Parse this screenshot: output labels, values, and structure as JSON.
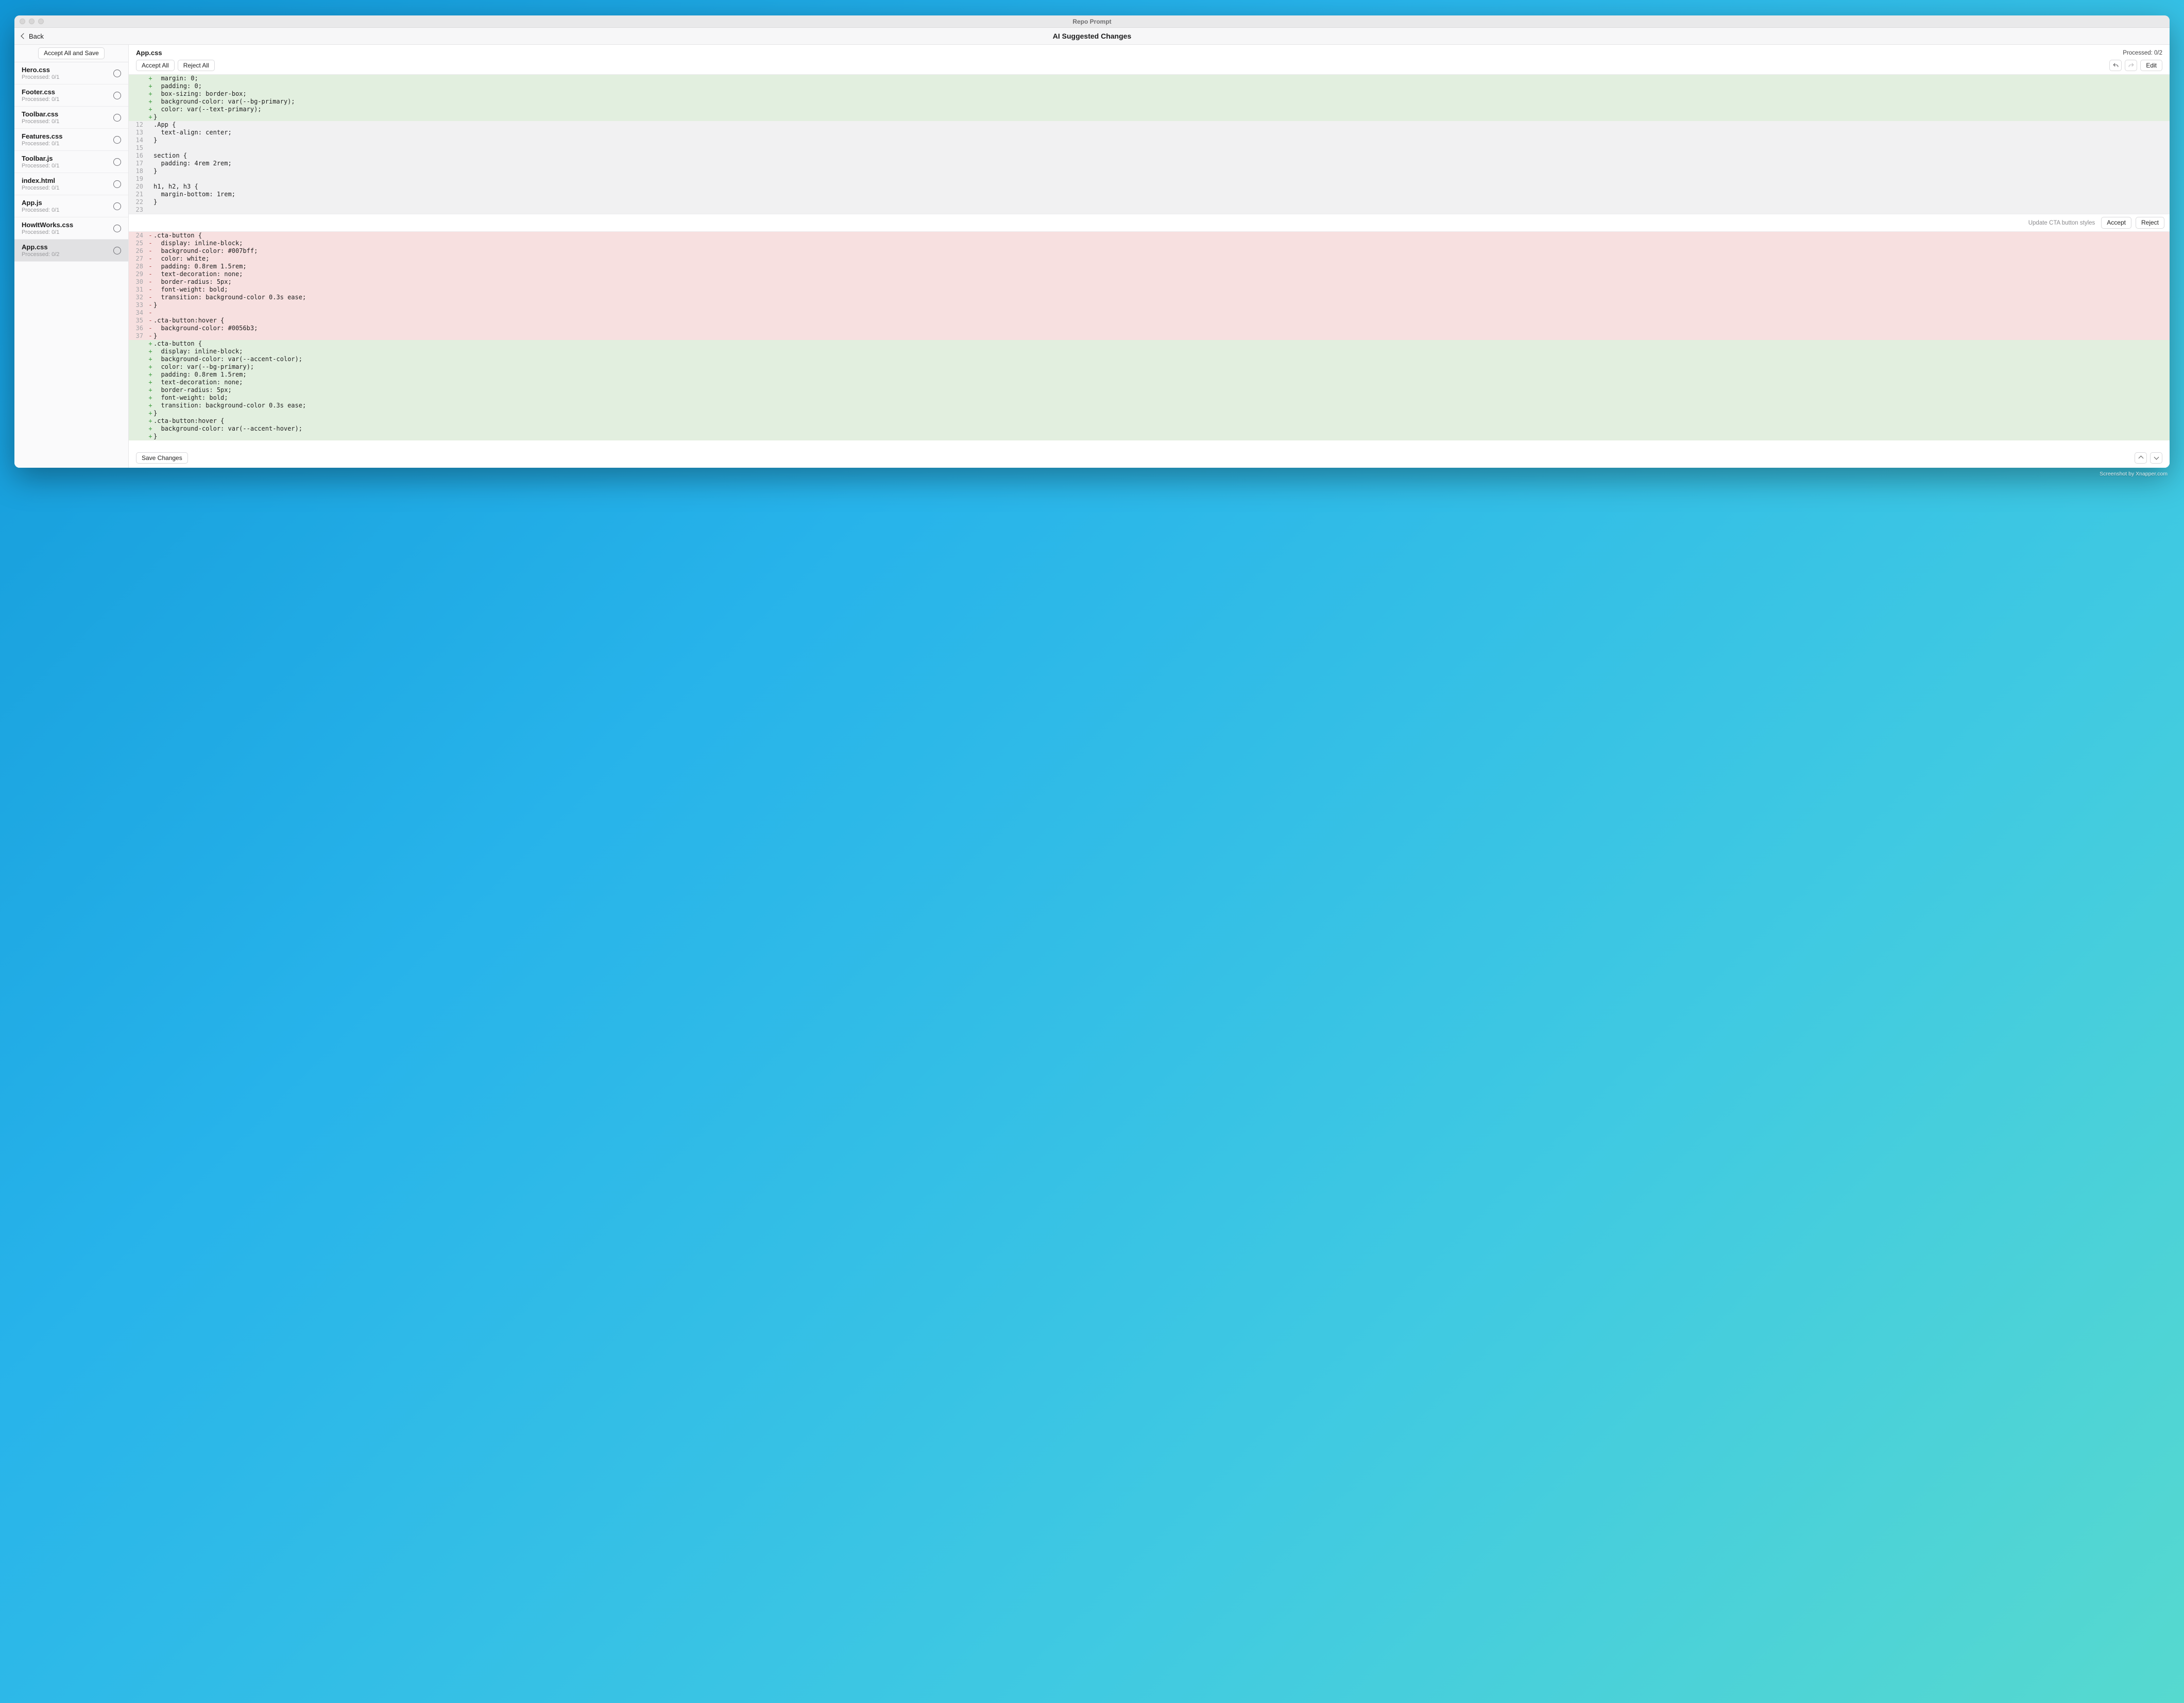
{
  "app": {
    "title": "Repo Prompt"
  },
  "header": {
    "back_label": "Back",
    "page_title": "AI Suggested Changes"
  },
  "sidebar": {
    "accept_all_save_label": "Accept All and Save",
    "files": [
      {
        "name": "Hero.css",
        "processed": "Processed: 0/1",
        "active": false
      },
      {
        "name": "Footer.css",
        "processed": "Processed: 0/1",
        "active": false
      },
      {
        "name": "Toolbar.css",
        "processed": "Processed: 0/1",
        "active": false
      },
      {
        "name": "Features.css",
        "processed": "Processed: 0/1",
        "active": false
      },
      {
        "name": "Toolbar.js",
        "processed": "Processed: 0/1",
        "active": false
      },
      {
        "name": "index.html",
        "processed": "Processed: 0/1",
        "active": false
      },
      {
        "name": "App.js",
        "processed": "Processed: 0/1",
        "active": false
      },
      {
        "name": "HowItWorks.css",
        "processed": "Processed: 0/1",
        "active": false
      },
      {
        "name": "App.css",
        "processed": "Processed: 0/2",
        "active": true
      }
    ]
  },
  "main": {
    "file_title": "App.css",
    "processed_label": "Processed: 0/2",
    "accept_all_label": "Accept All",
    "reject_all_label": "Reject All",
    "edit_label": "Edit",
    "save_changes_label": "Save Changes",
    "hunk2_desc": "Update CTA button styles",
    "accept_label": "Accept",
    "reject_label": "Reject"
  },
  "diff_block1": [
    {
      "num": "",
      "sign": "+",
      "type": "add",
      "code": "  margin: 0;"
    },
    {
      "num": "",
      "sign": "+",
      "type": "add",
      "code": "  padding: 0;"
    },
    {
      "num": "",
      "sign": "+",
      "type": "add",
      "code": "  box-sizing: border-box;"
    },
    {
      "num": "",
      "sign": "+",
      "type": "add",
      "code": "  background-color: var(--bg-primary);"
    },
    {
      "num": "",
      "sign": "+",
      "type": "add",
      "code": "  color: var(--text-primary);"
    },
    {
      "num": "",
      "sign": "+",
      "type": "add",
      "code": "}"
    },
    {
      "num": "12",
      "sign": "",
      "type": "ctx",
      "code": ".App {"
    },
    {
      "num": "13",
      "sign": "",
      "type": "ctx",
      "code": "  text-align: center;"
    },
    {
      "num": "14",
      "sign": "",
      "type": "ctx",
      "code": "}"
    },
    {
      "num": "15",
      "sign": "",
      "type": "ctx",
      "code": ""
    },
    {
      "num": "16",
      "sign": "",
      "type": "ctx",
      "code": "section {"
    },
    {
      "num": "17",
      "sign": "",
      "type": "ctx",
      "code": "  padding: 4rem 2rem;"
    },
    {
      "num": "18",
      "sign": "",
      "type": "ctx",
      "code": "}"
    },
    {
      "num": "19",
      "sign": "",
      "type": "ctx",
      "code": ""
    },
    {
      "num": "20",
      "sign": "",
      "type": "ctx",
      "code": "h1, h2, h3 {"
    },
    {
      "num": "21",
      "sign": "",
      "type": "ctx",
      "code": "  margin-bottom: 1rem;"
    },
    {
      "num": "22",
      "sign": "",
      "type": "ctx",
      "code": "}"
    },
    {
      "num": "23",
      "sign": "",
      "type": "ctx",
      "code": ""
    }
  ],
  "diff_block2": [
    {
      "num": "24",
      "sign": "-",
      "type": "del",
      "code": ".cta-button {"
    },
    {
      "num": "25",
      "sign": "-",
      "type": "del",
      "code": "  display: inline-block;"
    },
    {
      "num": "26",
      "sign": "-",
      "type": "del",
      "code": "  background-color: #007bff;"
    },
    {
      "num": "27",
      "sign": "-",
      "type": "del",
      "code": "  color: white;"
    },
    {
      "num": "28",
      "sign": "-",
      "type": "del",
      "code": "  padding: 0.8rem 1.5rem;"
    },
    {
      "num": "29",
      "sign": "-",
      "type": "del",
      "code": "  text-decoration: none;"
    },
    {
      "num": "30",
      "sign": "-",
      "type": "del",
      "code": "  border-radius: 5px;"
    },
    {
      "num": "31",
      "sign": "-",
      "type": "del",
      "code": "  font-weight: bold;"
    },
    {
      "num": "32",
      "sign": "-",
      "type": "del",
      "code": "  transition: background-color 0.3s ease;"
    },
    {
      "num": "33",
      "sign": "-",
      "type": "del",
      "code": "}"
    },
    {
      "num": "34",
      "sign": "-",
      "type": "del",
      "code": ""
    },
    {
      "num": "35",
      "sign": "-",
      "type": "del",
      "code": ".cta-button:hover {"
    },
    {
      "num": "36",
      "sign": "-",
      "type": "del",
      "code": "  background-color: #0056b3;"
    },
    {
      "num": "37",
      "sign": "-",
      "type": "del",
      "code": "}"
    },
    {
      "num": "",
      "sign": "+",
      "type": "add",
      "code": ".cta-button {"
    },
    {
      "num": "",
      "sign": "+",
      "type": "add",
      "code": "  display: inline-block;"
    },
    {
      "num": "",
      "sign": "+",
      "type": "add",
      "code": "  background-color: var(--accent-color);"
    },
    {
      "num": "",
      "sign": "+",
      "type": "add",
      "code": "  color: var(--bg-primary);"
    },
    {
      "num": "",
      "sign": "+",
      "type": "add",
      "code": "  padding: 0.8rem 1.5rem;"
    },
    {
      "num": "",
      "sign": "+",
      "type": "add",
      "code": "  text-decoration: none;"
    },
    {
      "num": "",
      "sign": "+",
      "type": "add",
      "code": "  border-radius: 5px;"
    },
    {
      "num": "",
      "sign": "+",
      "type": "add",
      "code": "  font-weight: bold;"
    },
    {
      "num": "",
      "sign": "+",
      "type": "add",
      "code": "  transition: background-color 0.3s ease;"
    },
    {
      "num": "",
      "sign": "+",
      "type": "add",
      "code": "}"
    },
    {
      "num": "",
      "sign": "+",
      "type": "add",
      "code": ".cta-button:hover {"
    },
    {
      "num": "",
      "sign": "+",
      "type": "add",
      "code": "  background-color: var(--accent-hover);"
    },
    {
      "num": "",
      "sign": "+",
      "type": "add",
      "code": "}"
    }
  ],
  "watermark": "Screenshot by Xnapper.com"
}
